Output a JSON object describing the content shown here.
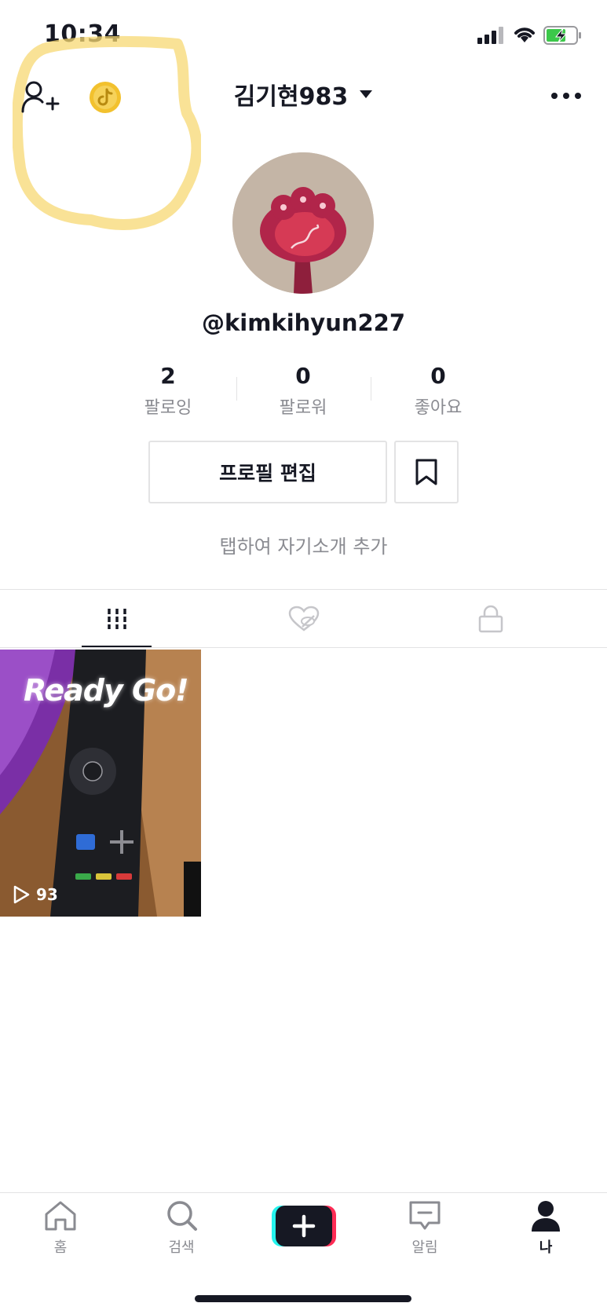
{
  "status_bar": {
    "time": "10:34"
  },
  "header": {
    "username": "김기현983"
  },
  "profile": {
    "handle": "@kimkihyun227",
    "stats": [
      {
        "value": "2",
        "label": "팔로잉"
      },
      {
        "value": "0",
        "label": "팔로워"
      },
      {
        "value": "0",
        "label": "좋아요"
      }
    ],
    "edit_profile_label": "프로필 편집",
    "bio_prompt": "탭하여 자기소개 추가"
  },
  "videos": [
    {
      "caption_overlay": "Ready Go!",
      "views": "93"
    }
  ],
  "bottom_nav": {
    "items": [
      {
        "label": "홈",
        "icon": "home-icon"
      },
      {
        "label": "검색",
        "icon": "search-icon"
      },
      {
        "label": "",
        "icon": "plus-icon"
      },
      {
        "label": "알림",
        "icon": "inbox-icon"
      },
      {
        "label": "나",
        "icon": "profile-icon"
      }
    ]
  },
  "colors": {
    "text": "#161823",
    "muted": "#8a8b91",
    "highlight": "#f7d873",
    "coin": "#f2c12e",
    "tiktok_cyan": "#25f4ee",
    "tiktok_red": "#fe2c55"
  }
}
